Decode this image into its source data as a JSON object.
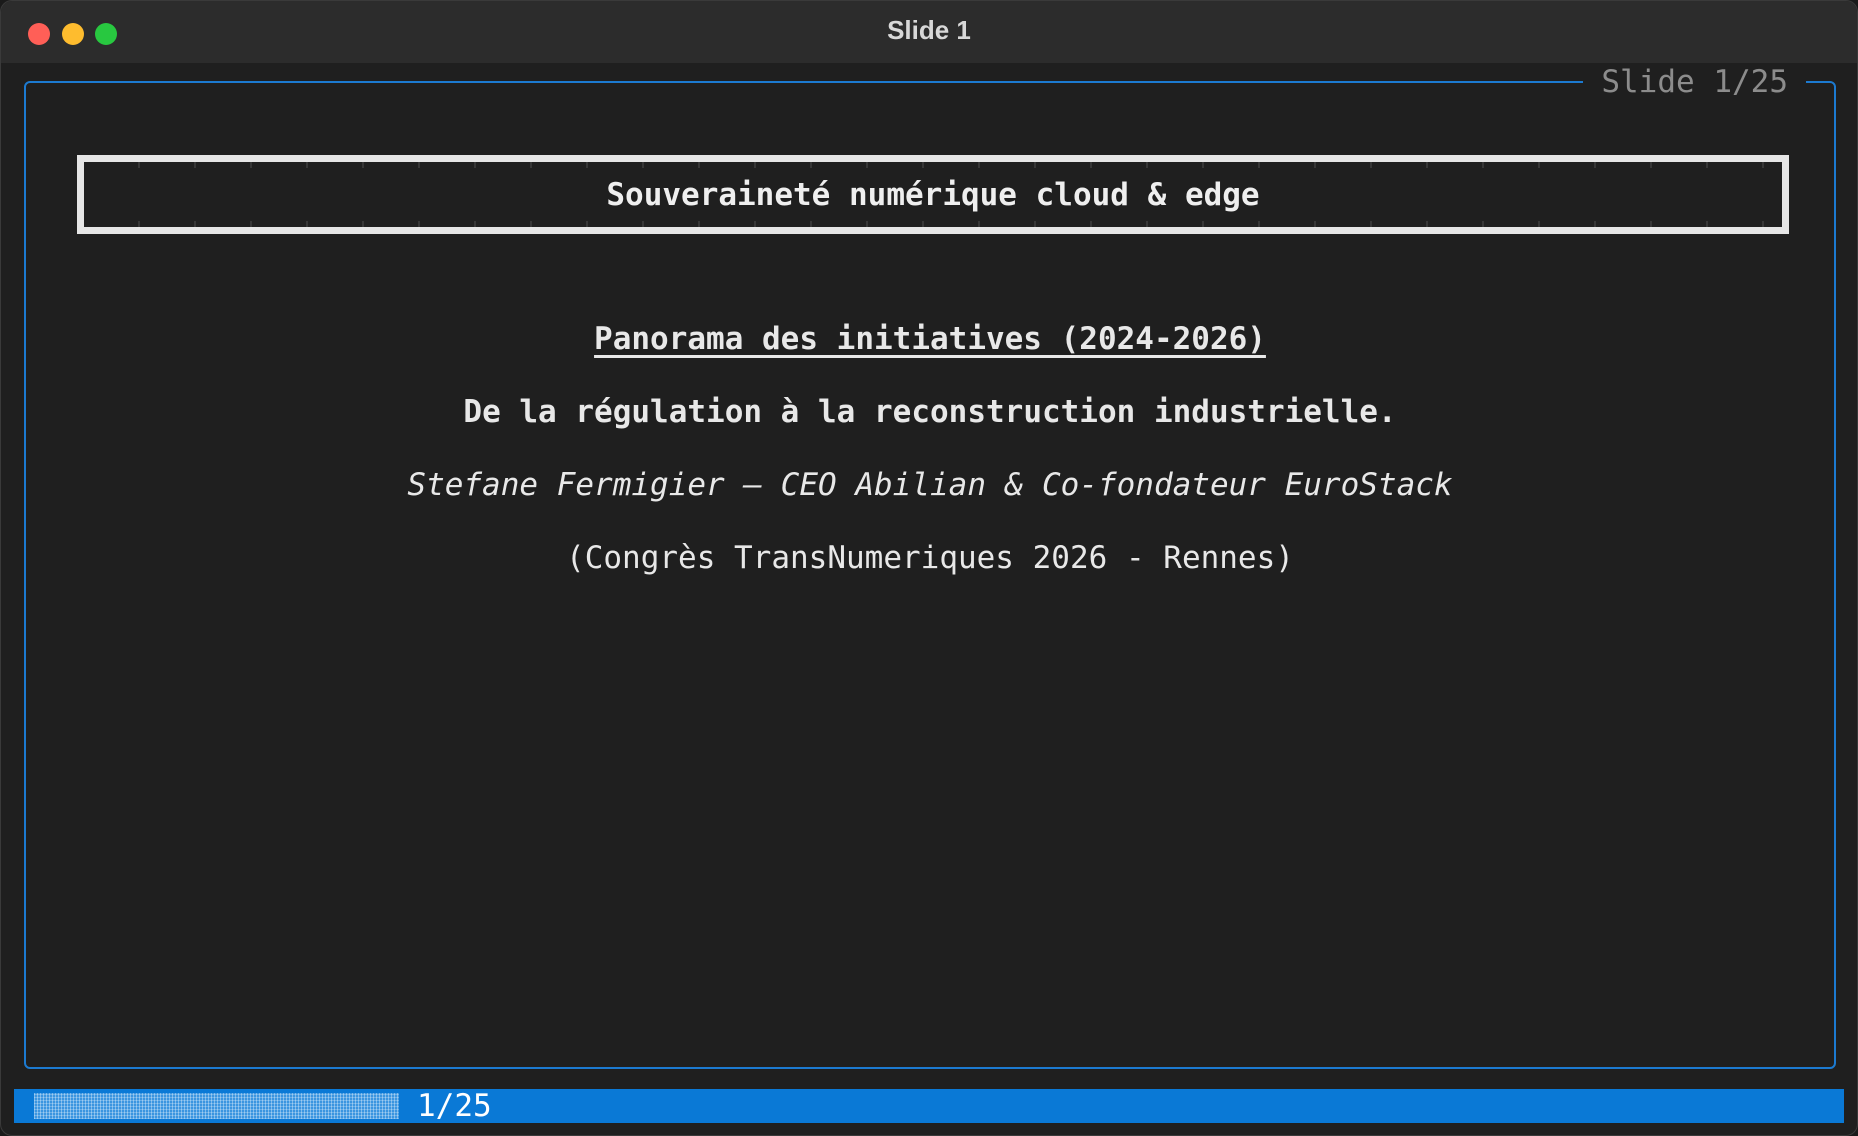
{
  "window": {
    "title": "Slide 1"
  },
  "frame": {
    "label": "Slide 1/25"
  },
  "slide": {
    "heading": "Souveraineté numérique cloud & edge",
    "subtitle": "Panorama des initiatives (2024-2026)",
    "tagline": "De la régulation à la reconstruction industrielle.",
    "author": "Stefane Fermigier — CEO Abilian & Co-fondateur EuroStack",
    "event": "(Congrès TransNumeriques 2026 - Rennes)"
  },
  "statusbar": {
    "counter": "1/25",
    "progress_fraction": 0.04,
    "accent_color": "#0a79d6"
  }
}
